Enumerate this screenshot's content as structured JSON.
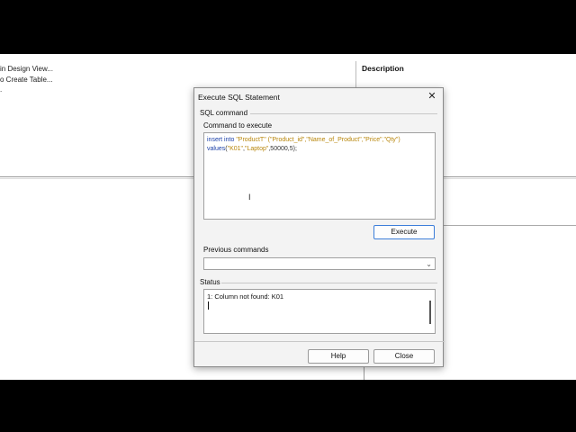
{
  "background": {
    "tasks": [
      "in Design View...",
      "o Create Table...",
      "."
    ],
    "description_header": "Description"
  },
  "dialog": {
    "title": "Execute SQL Statement",
    "close_icon": "close-icon",
    "sql_section_label": "SQL command",
    "command_label": "Command to execute",
    "command_text": {
      "line1": {
        "kw": "insert into",
        "table": "\"ProductT\"",
        "cols": "(\"Product_id\",\"Name_of_Product\",\"Price\",\"Qty\")"
      },
      "line2": {
        "kw": "values",
        "open": "(",
        "v1": "\"K01\"",
        "comma1": ",",
        "v2": "\"Laptop\"",
        "rest": ",50000,5);"
      }
    },
    "execute_label": "Execute",
    "previous_label": "Previous commands",
    "previous_value": "",
    "status_label": "Status",
    "status_text": "1: Column not found: K01",
    "help_label": "Help",
    "close_label": "Close"
  }
}
